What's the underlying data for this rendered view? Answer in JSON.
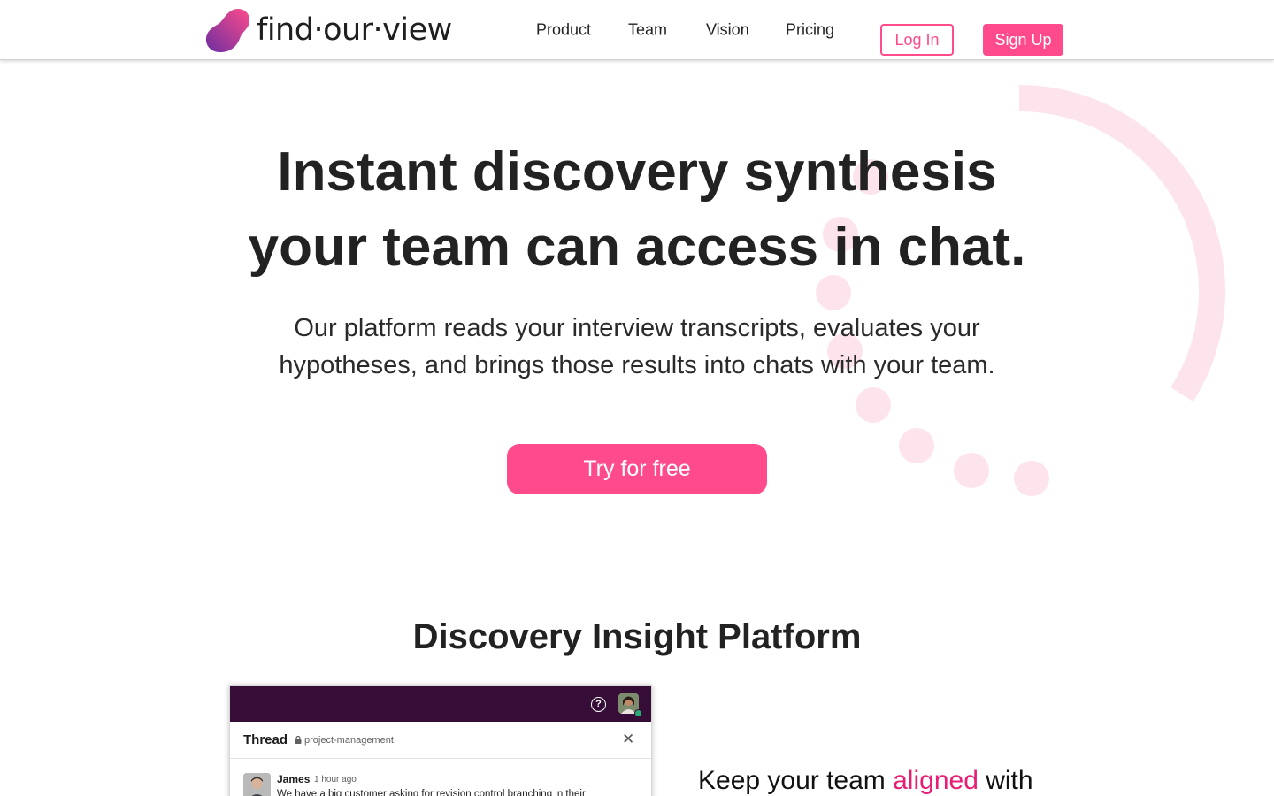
{
  "brand": {
    "logo_text": "find·our·view",
    "accent": "#ff4b8c",
    "gradient": [
      "#ff4b8c",
      "#6b2fa0"
    ]
  },
  "nav": {
    "items": [
      {
        "label": "Product"
      },
      {
        "label": "Team"
      },
      {
        "label": "Vision"
      },
      {
        "label": "Pricing"
      }
    ],
    "login_label": "Log In",
    "signup_label": "Sign Up"
  },
  "hero": {
    "title_line1": "Instant discovery synthesis",
    "title_line2": "your team can access in chat.",
    "subtitle_line1": "Our platform reads your interview transcripts, evaluates your",
    "subtitle_line2": "hypotheses, and brings those results into chats with your team.",
    "cta_label": "Try for free"
  },
  "section": {
    "title": "Discovery Insight Platform"
  },
  "chat_mock": {
    "bar_color": "#350d36",
    "help_glyph": "?",
    "thread_title": "Thread",
    "channel": "project-management",
    "close_glyph": "✕",
    "message": {
      "author": "James",
      "time": "1 hour ago",
      "text": "We have a big customer asking for revision control branching in their"
    }
  },
  "feature": {
    "text_before": "Keep your team ",
    "text_accent": "aligned",
    "text_after": " with"
  }
}
